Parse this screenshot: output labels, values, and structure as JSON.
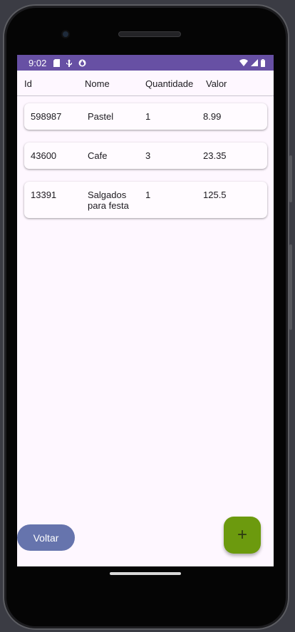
{
  "status_bar": {
    "time": "9:02",
    "left_icons": [
      "sd-card-icon",
      "usb-debug-icon",
      "sync-icon"
    ],
    "right_icons": [
      "wifi-icon",
      "signal-icon",
      "battery-icon"
    ]
  },
  "table": {
    "headers": {
      "id": "Id",
      "nome": "Nome",
      "quantidade": "Quantidade",
      "valor": "Valor"
    },
    "rows": [
      {
        "id": "598987",
        "nome": "Pastel",
        "quantidade": "1",
        "valor": "8.99"
      },
      {
        "id": "43600",
        "nome": "Cafe",
        "quantidade": "3",
        "valor": "23.35"
      },
      {
        "id": "13391",
        "nome": "Salgados para festa",
        "quantidade": "1",
        "valor": "125.5"
      }
    ]
  },
  "buttons": {
    "back_label": "Voltar",
    "add_label": "+"
  },
  "colors": {
    "status_bar": "#6750a4",
    "back_button": "#6674ad",
    "fab": "#6c9a0e",
    "screen_bg": "#fef7ff"
  }
}
